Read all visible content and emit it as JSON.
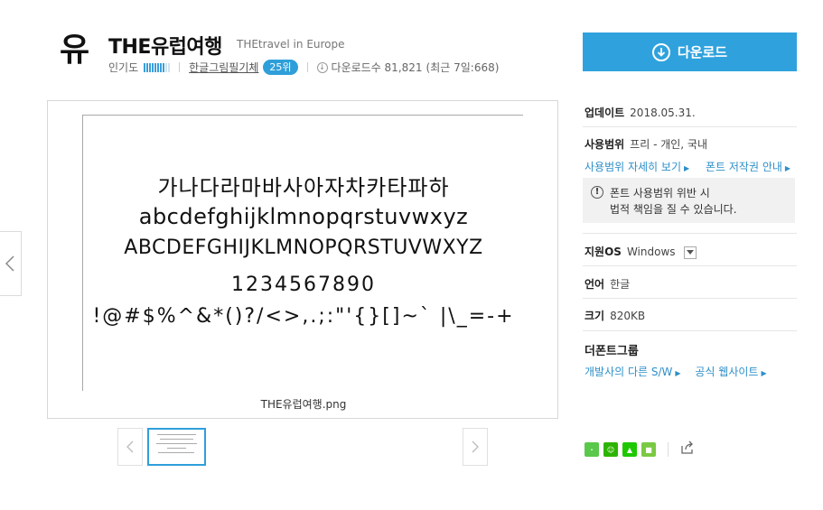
{
  "header": {
    "logo_glyph": "유",
    "title": "THE유럽여행",
    "subtitle": "THEtravel in Europe",
    "popularity_label": "인기도",
    "popularity_level": 0.8,
    "maker": "한글그림필기체",
    "rank": "25위",
    "downloads_label": "다운로드수 81,821",
    "downloads_recent": "(최근 7일:668)"
  },
  "preview": {
    "specimen_lines": [
      "가나다라마바사아자차카타파하",
      "abcdefghijklmnopqrstuvwxyz",
      "ABCDEFGHIJKLMNOPQRSTUVWXYZ",
      "1234567890",
      "!@#$%^&*()?/<>,.;:\"'{}[]~` |\\_=-+"
    ],
    "filename": "THE유럽여행.png"
  },
  "sidebar": {
    "download_label": "다운로드",
    "update_key": "업데이트",
    "update_value": "2018.05.31.",
    "license_key": "사용범위",
    "license_value": "프리 - 개인, 국내",
    "license_detail_link": "사용범위 자세히 보기",
    "copyright_link": "폰트 저작권 안내",
    "notice_line1": "폰트 사용범위 위반 시",
    "notice_line2": "법적 책임을 질 수 있습니다.",
    "os_key": "지원OS",
    "os_value": "Windows",
    "lang_key": "언어",
    "lang_value": "한글",
    "size_key": "크기",
    "size_value": "820KB",
    "group_title": "더폰트그룹",
    "dev_link": "개발사의 다른 S/W",
    "site_link": "공식 웹사이트"
  },
  "colors": {
    "accent": "#2fa2dd",
    "link": "#2e8fc9"
  }
}
